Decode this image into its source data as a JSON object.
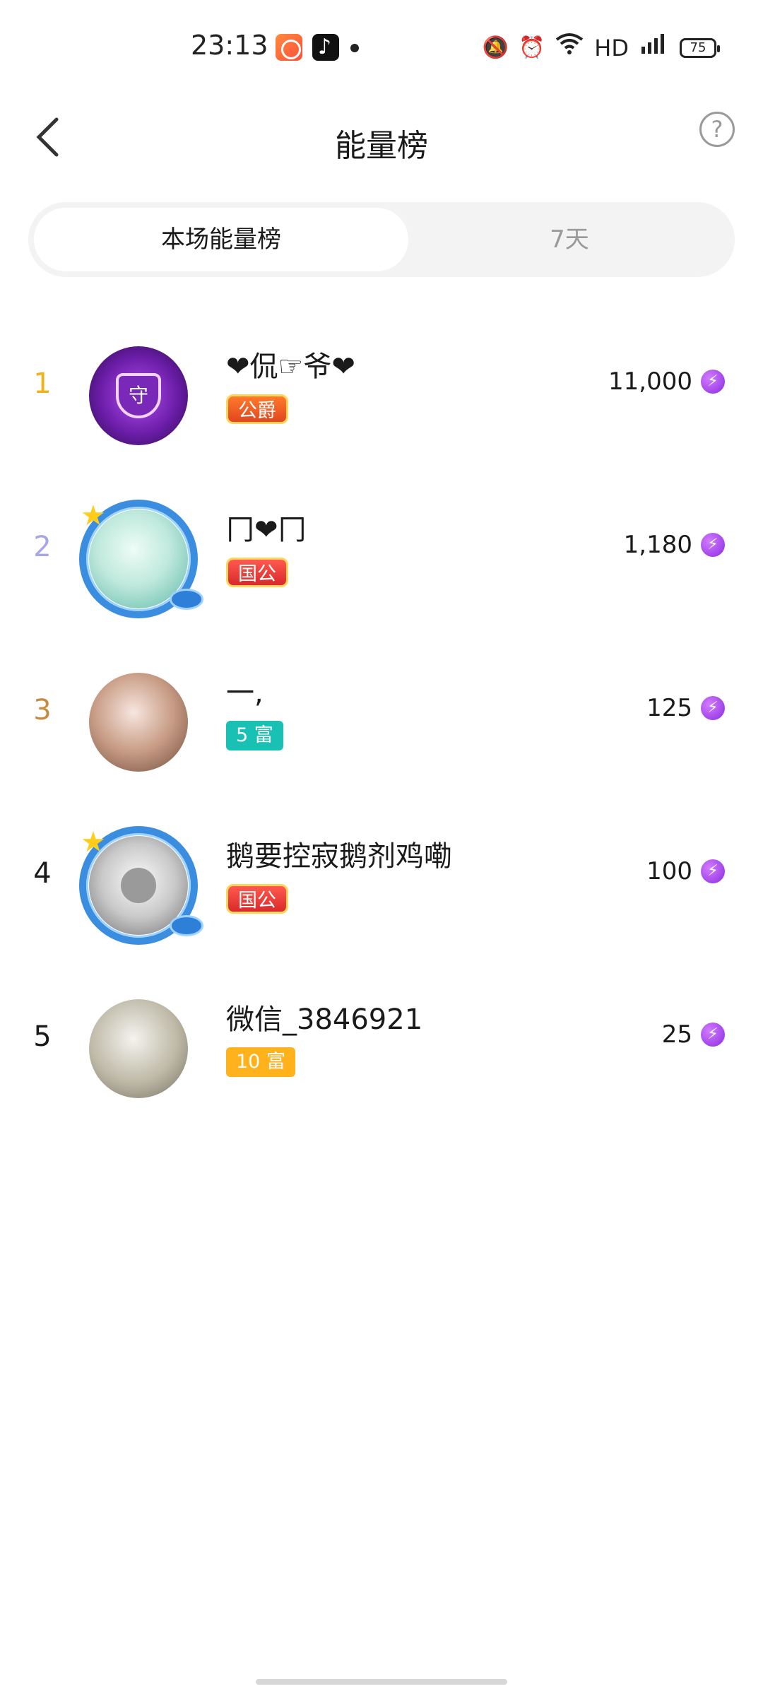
{
  "status_bar": {
    "time": "23:13",
    "network": "HD",
    "battery": "75",
    "icons": [
      "kuaishou-app-icon",
      "tiktok-app-icon",
      "notification-dot",
      "mute-bell-icon",
      "alarm-icon",
      "wifi-icon",
      "4g-signal-icon",
      "battery-icon"
    ]
  },
  "header": {
    "title": "能量榜",
    "help_icon": "?"
  },
  "tabs": [
    {
      "label": "本场能量榜",
      "active": true
    },
    {
      "label": "7天",
      "active": false
    }
  ],
  "colors": {
    "rank1": "#f0b21c",
    "rank2": "#a7a6e6",
    "rank3": "#c98a3f",
    "rank_default": "#1a1a1a",
    "energy": "#8b2be0"
  },
  "ranking": [
    {
      "rank": "1",
      "name": "❤侃☞爷❤",
      "badge": "公爵",
      "score": "11,000"
    },
    {
      "rank": "2",
      "name": "冂❤冂",
      "badge": "国公",
      "score": "1,180"
    },
    {
      "rank": "3",
      "name": "一,",
      "badge": "5 富",
      "score": "125"
    },
    {
      "rank": "4",
      "name": "鹅要控寂鹅剂鸡嘞",
      "badge": "国公",
      "score": "100"
    },
    {
      "rank": "5",
      "name": "微信_3846921",
      "badge": "10 富",
      "score": "25"
    }
  ]
}
